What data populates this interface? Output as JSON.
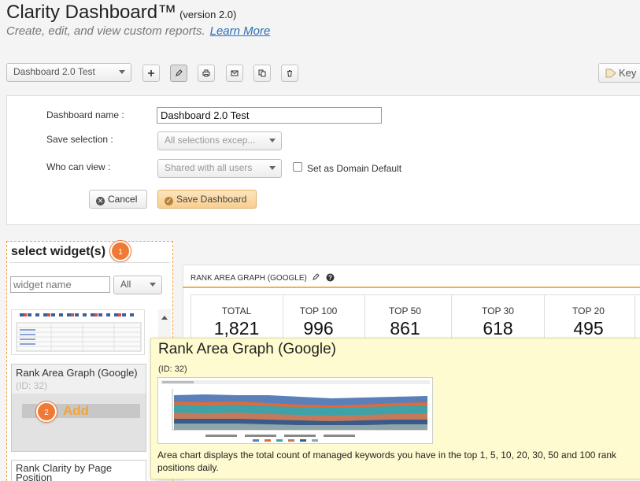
{
  "header": {
    "title": "Clarity Dashboard™",
    "version": "(version 2.0)",
    "subtitle": "Create, edit, and view custom reports.",
    "learn_more": "Learn More"
  },
  "toolbar": {
    "dashboard_select": "Dashboard 2.0 Test",
    "icons": [
      "plus-icon",
      "pencil-icon",
      "print-icon",
      "mail-icon",
      "copy-icon",
      "trash-icon"
    ],
    "keywords_button": "Key"
  },
  "form": {
    "name_label": "Dashboard name :",
    "name_value": "Dashboard 2.0 Test",
    "save_label": "Save selection :",
    "save_value": "All selections excep...",
    "view_label": "Who can view :",
    "view_value": "Shared with all users",
    "domain_default": "Set as Domain Default",
    "cancel": "Cancel",
    "save": "Save Dashboard"
  },
  "widgets": {
    "title": "select widget(s)",
    "step1": "1",
    "search_placeholder": "widget name",
    "filter": "All",
    "card_title": "Rank Area Graph (Google)",
    "card_id": "(ID: 32)",
    "step2": "2",
    "add": "Add",
    "card2_title": "Rank Clarity by Page Position"
  },
  "graph": {
    "title": "RANK AREA GRAPH (GOOGLE)",
    "stats": [
      {
        "label": "TOTAL",
        "value": "1,821"
      },
      {
        "label": "TOP 100",
        "value": "996"
      },
      {
        "label": "TOP 50",
        "value": "861"
      },
      {
        "label": "TOP 30",
        "value": "618"
      },
      {
        "label": "TOP 20",
        "value": "495"
      }
    ]
  },
  "popover": {
    "title": "Rank Area Graph (Google)",
    "id": "(ID: 32)",
    "description": "Area chart displays the total count of managed keywords you have in the top 1, 5, 10, 20, 30, 50 and 100 rank positions daily."
  },
  "colors": {
    "accent": "#ef7a35",
    "link": "#2a6ebb",
    "popover_bg": "#fffbd0",
    "save_button": "#f9cf90"
  }
}
